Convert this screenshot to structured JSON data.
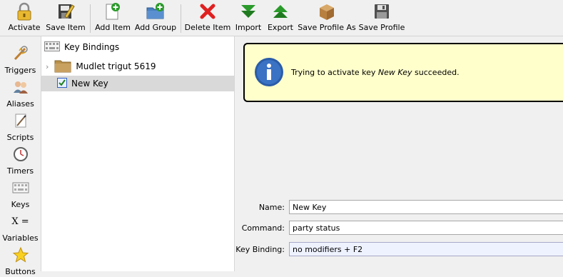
{
  "toolbar": {
    "activate": "Activate",
    "save_item": "Save Item",
    "add_item": "Add Item",
    "add_group": "Add Group",
    "delete_item": "Delete Item",
    "import": "Import",
    "export": "Export",
    "save_profile_as": "Save Profile As",
    "save_profile": "Save Profile"
  },
  "sidebar": {
    "items": [
      {
        "label": "Triggers",
        "icon": "triggers-icon"
      },
      {
        "label": "Aliases",
        "icon": "aliases-icon"
      },
      {
        "label": "Scripts",
        "icon": "scripts-icon"
      },
      {
        "label": "Timers",
        "icon": "timers-icon"
      },
      {
        "label": "Keys",
        "icon": "keys-icon"
      },
      {
        "label": "Variables",
        "icon": "variables-icon",
        "glyph": "X ="
      },
      {
        "label": "Buttons",
        "icon": "buttons-icon"
      }
    ]
  },
  "tree": {
    "root": "Key Bindings",
    "group": "Mudlet trigut 5619",
    "item": "New Key"
  },
  "banner": {
    "prefix": "Trying to activate key ",
    "key_name": "New Key",
    "suffix": " succeeded."
  },
  "form": {
    "name_label": "Name:",
    "name_value": "New Key",
    "command_label": "Command:",
    "command_value": "party status",
    "binding_label": "Key Binding:",
    "binding_value": "no modifiers + F2"
  },
  "colors": {
    "banner_bg": "#ffffcc",
    "selection": "#d9d9d9",
    "delete_red": "#e02020",
    "import_green": "#2a9a2a"
  }
}
